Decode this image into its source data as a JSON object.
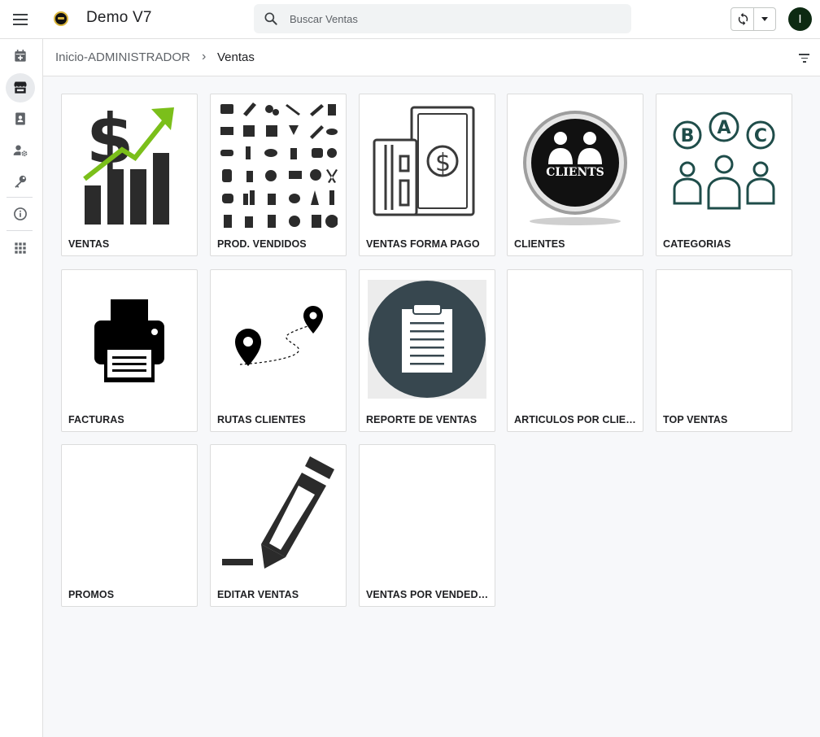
{
  "header": {
    "app_title": "Demo V7",
    "search_placeholder": "Buscar Ventas",
    "avatar_initial": "I"
  },
  "breadcrumb": {
    "parent": "Inicio-ADMINISTRADOR",
    "separator": "›",
    "current": "Ventas"
  },
  "sidebar": {
    "items": [
      {
        "icon": "calendar-add-icon",
        "active": false
      },
      {
        "icon": "store-icon",
        "active": true
      },
      {
        "icon": "contact-book-icon",
        "active": false
      },
      {
        "icon": "user-settings-icon",
        "active": false
      },
      {
        "icon": "key-icon",
        "active": false
      },
      {
        "icon": "info-icon",
        "active": false
      },
      {
        "icon": "apps-grid-icon",
        "active": false
      }
    ]
  },
  "cards": [
    {
      "label": "VENTAS",
      "icon": "sales-chart-image"
    },
    {
      "label": "PROD. VENDIDOS",
      "icon": "products-grid-image"
    },
    {
      "label": "VENTAS FORMA PAGO",
      "icon": "payment-method-image"
    },
    {
      "label": "CLIENTES",
      "icon": "clients-badge-image",
      "badge_text": "CLIENTS"
    },
    {
      "label": "CATEGORIAS",
      "icon": "categories-abc-image",
      "letters": [
        "B",
        "A",
        "C"
      ]
    },
    {
      "label": "FACTURAS",
      "icon": "printer-image"
    },
    {
      "label": "RUTAS CLIENTES",
      "icon": "route-pins-image"
    },
    {
      "label": "REPORTE DE VENTAS",
      "icon": "clipboard-report-image"
    },
    {
      "label": "ARTICULOS POR CLIENTE",
      "icon": ""
    },
    {
      "label": "TOP VENTAS",
      "icon": ""
    },
    {
      "label": "PROMOS",
      "icon": ""
    },
    {
      "label": "EDITAR VENTAS",
      "icon": "pencil-edit-image"
    },
    {
      "label": "VENTAS POR VENDEDOR",
      "icon": ""
    }
  ],
  "colors": {
    "arrow_green": "#7bbf1a",
    "category_teal": "#1f4d4a",
    "report_circle": "#37474f",
    "avatar_bg": "#0d2a12"
  }
}
